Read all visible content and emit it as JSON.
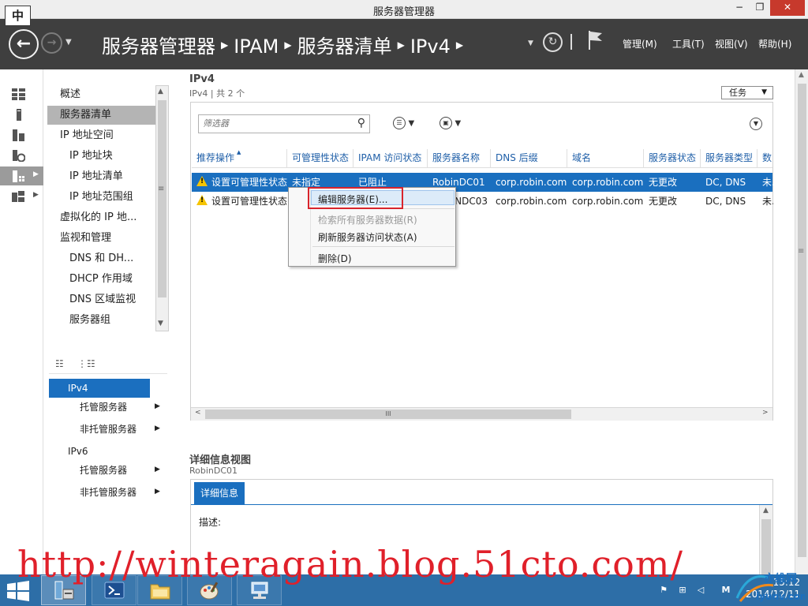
{
  "window": {
    "ime": "中",
    "title": "服务器管理器",
    "min": "−",
    "max": "❐",
    "close": "✕"
  },
  "header": {
    "back_icon": "←",
    "forward_icon": "→",
    "history_dropdown": "▼",
    "breadcrumb": [
      "服务器管理器",
      "IPAM",
      "服务器清单",
      "IPv4"
    ],
    "refresh_icon": "↻",
    "dropdown": "▼",
    "menus": [
      "管理(M)",
      "工具(T)",
      "视图(V)",
      "帮助(H)"
    ]
  },
  "rail": {
    "icons": [
      "dashboard-icon",
      "local-server-icon",
      "all-servers-icon",
      "file-storage-icon",
      "ipam-icon",
      "roles-icon"
    ],
    "active_index": 4
  },
  "nav": {
    "items": [
      "概述",
      "服务器清单",
      "IP 地址空间",
      "IP 地址块",
      "IP 地址清单",
      "IP 地址范围组",
      "虚拟化的 IP 地...",
      "监视和管理",
      "DNS 和 DH...",
      "DHCP 作用域",
      "DNS 区域监视",
      "服务器组"
    ],
    "selected_index": 1,
    "scroll_up": "▲",
    "scroll_down": "▼",
    "scroll_grip": "≡"
  },
  "tree": {
    "items": [
      {
        "label": "IPv4",
        "arrow": ""
      },
      {
        "label": "托管服务器",
        "arrow": "▶"
      },
      {
        "label": "非托管服务器",
        "arrow": "▶"
      },
      {
        "label": "IPv6",
        "arrow": ""
      },
      {
        "label": "托管服务器",
        "arrow": "▶"
      },
      {
        "label": "非托管服务器",
        "arrow": "▶"
      }
    ],
    "selected_index": 0,
    "toolbar_icons": [
      "☷",
      "⋮☷"
    ]
  },
  "main": {
    "title": "IPv4",
    "subtitle": "IPv4 | 共 2 个",
    "tasks_label": "任务",
    "tasks_dd": "▼",
    "filter_placeholder": "筛选器",
    "filter_icon": "⚲",
    "view_icon": "☰",
    "save_icon": "▣",
    "dd": "▼",
    "collapse_icon": "▼",
    "columns": [
      "推荐操作",
      "可管理性状态",
      "IPAM 访问状态",
      "服务器名称",
      "DNS 后缀",
      "域名",
      "服务器状态",
      "服务器类型",
      "数"
    ],
    "sort_icon": "▲",
    "rows": [
      [
        "设置可管理性状态",
        "未指定",
        "已阻止",
        "RobinDC01",
        "corp.robin.com",
        "corp.robin.com",
        "无更改",
        "DC, DNS",
        "未."
      ],
      [
        "设置可管理性状态",
        "",
        "",
        "NDC03",
        "corp.robin.com",
        "corp.robin.com",
        "无更改",
        "DC, DNS",
        "未."
      ]
    ],
    "selected_row": 0,
    "hscroll_left": "<",
    "hscroll_right": ">",
    "hscroll_grip": "III"
  },
  "context_menu": {
    "items": [
      {
        "label": "编辑服务器(E)...",
        "disabled": false
      },
      {
        "label": "检索所有服务器数据(R)",
        "disabled": true
      },
      {
        "label": "刷新服务器访问状态(A)",
        "disabled": false
      },
      {
        "label": "删除(D)",
        "disabled": false
      }
    ],
    "highlighted_index": 0
  },
  "details": {
    "title": "详细信息视图",
    "subtitle": "RobinDC01",
    "tab": "详细信息",
    "desc_label": "描述:"
  },
  "watermark": "http://winteragain.blog.51cto.com/",
  "taskbar": {
    "apps": [
      "server-manager-icon",
      "powershell-icon",
      "file-explorer-icon",
      "paint-icon",
      "network-icon"
    ],
    "active_index": 0,
    "tray_icons": [
      "⚑",
      "⊞",
      "◁",
      "M"
    ],
    "clock_time": "15:12",
    "clock_date": "2014/12/11"
  },
  "colors": {
    "header_bg": "#3f3f3f",
    "accent": "#1a6fbf",
    "taskbar": "#2d6ea7",
    "highlight_box": "#d8242c",
    "warning": "#f5c400"
  }
}
